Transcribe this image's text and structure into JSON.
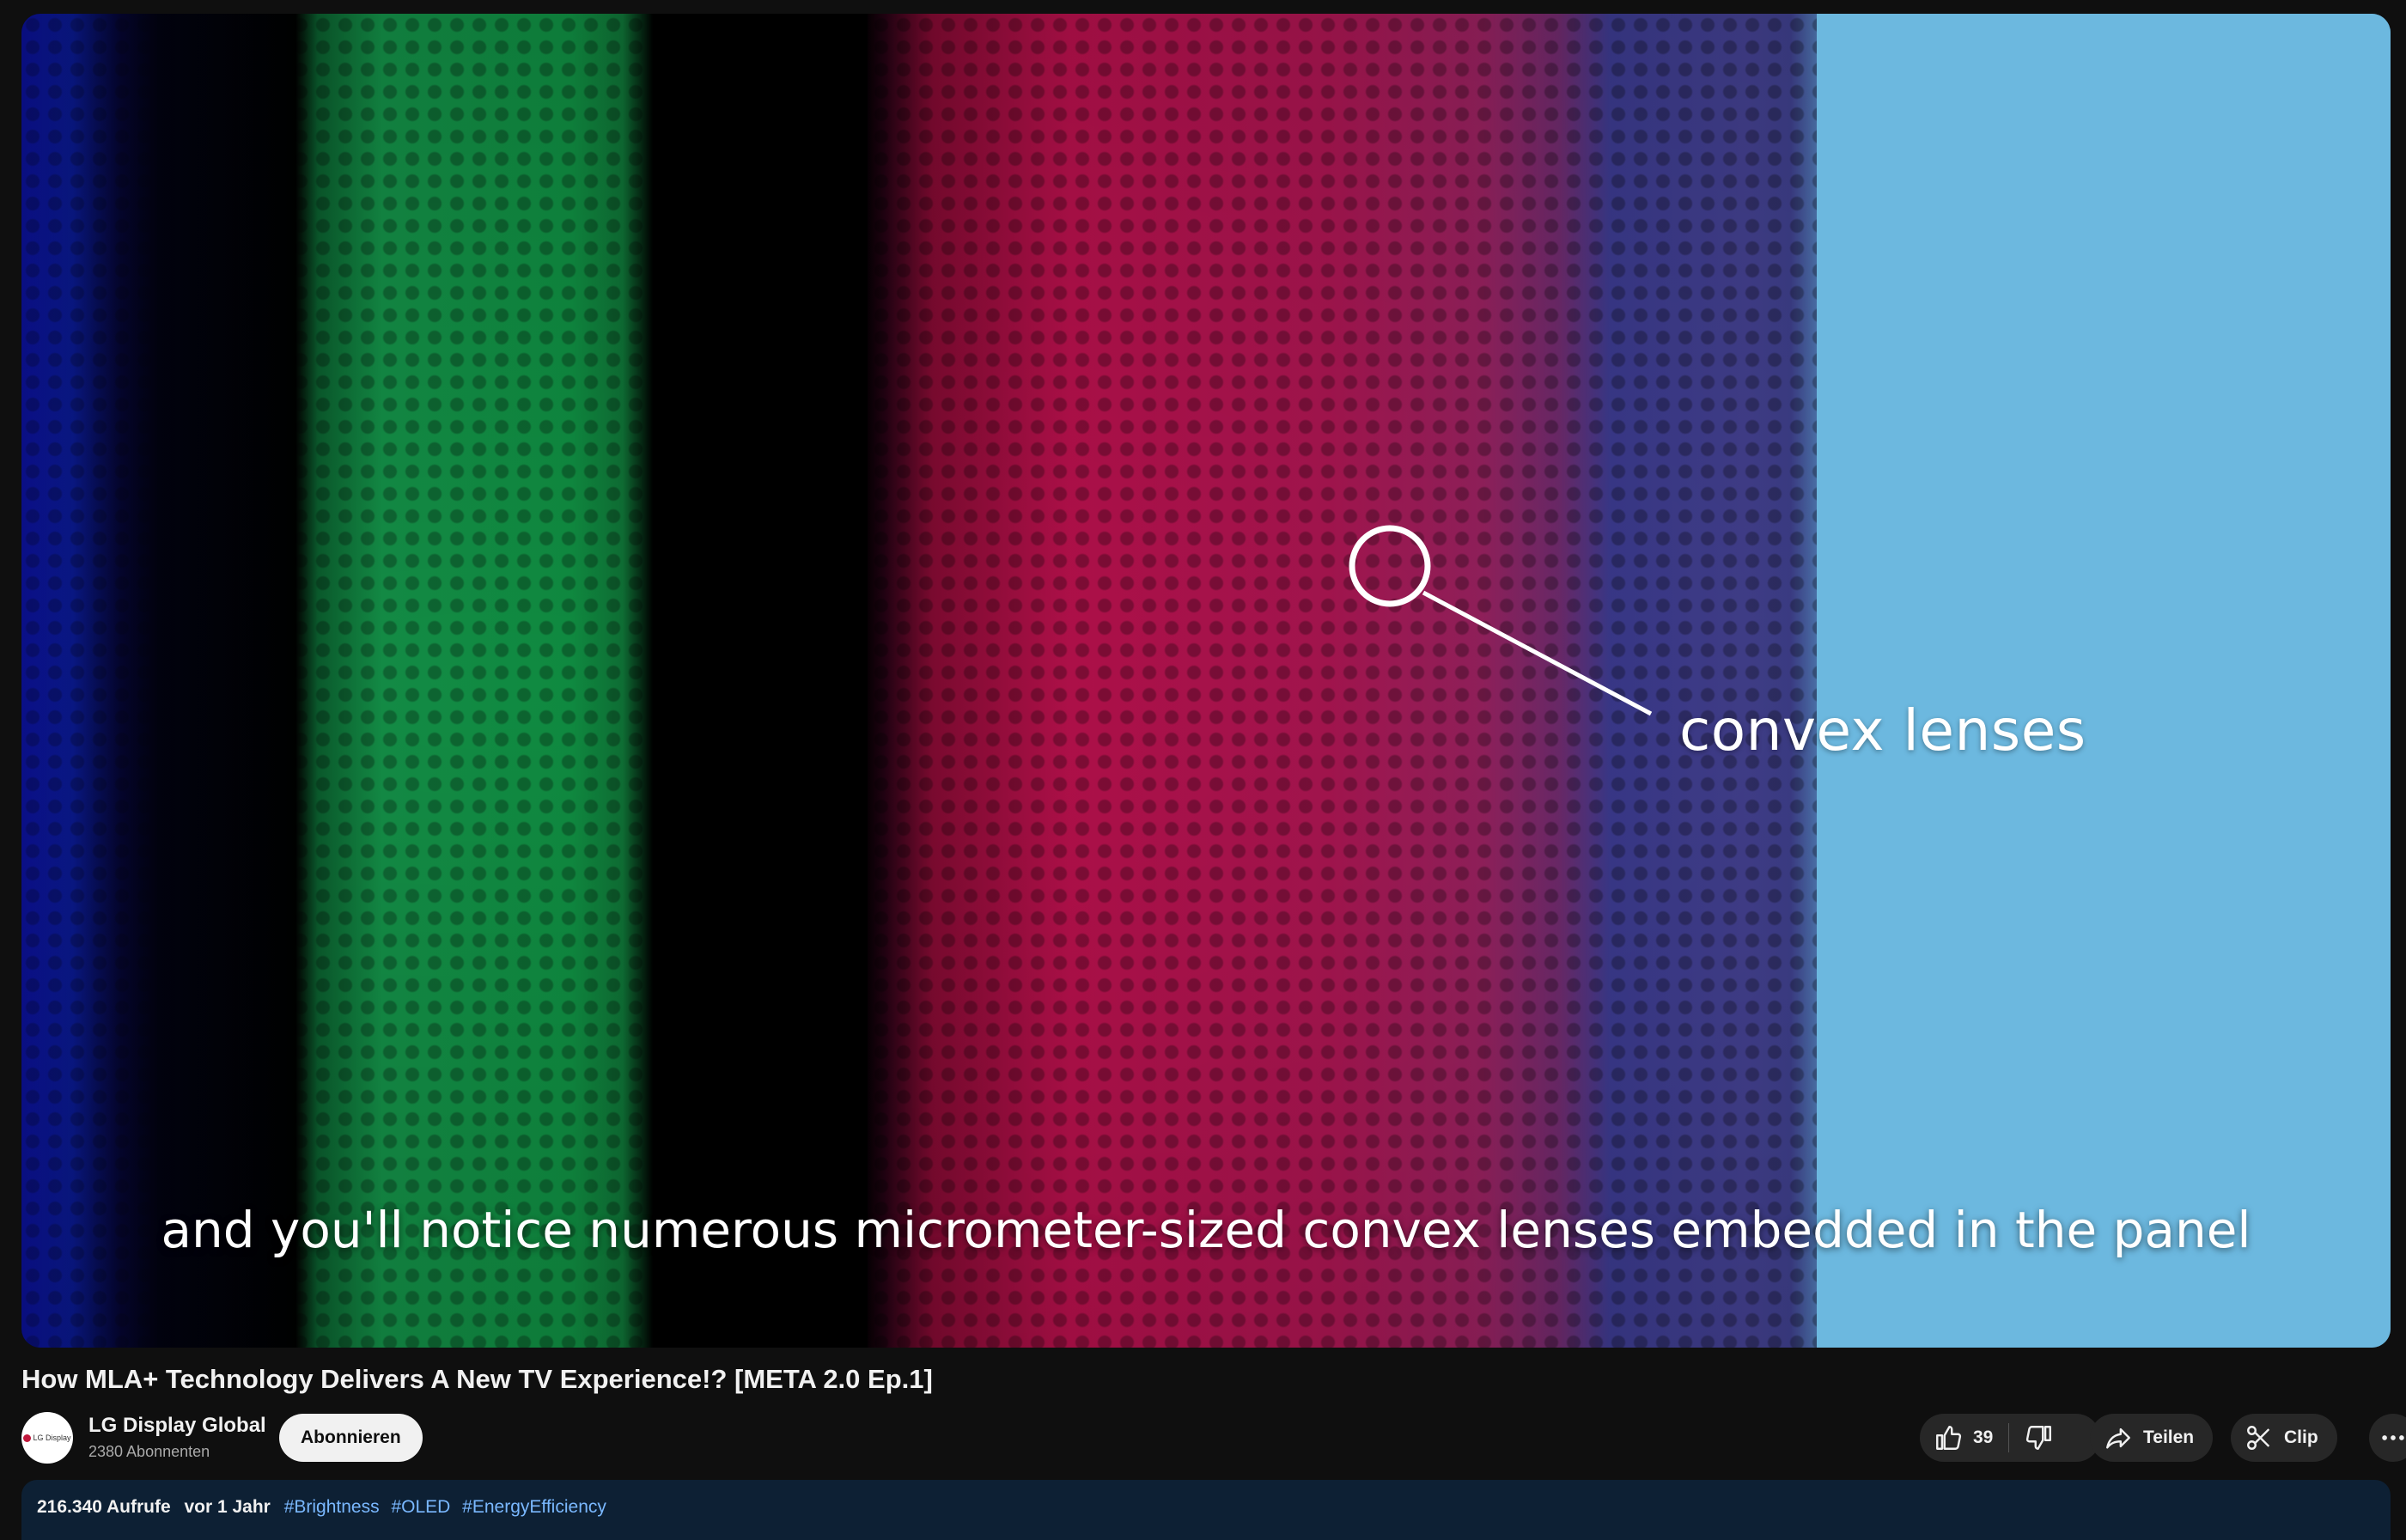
{
  "video": {
    "callout_label": "convex lenses",
    "caption": "and you'll notice numerous micrometer-sized convex lenses embedded in the panel"
  },
  "title": "How MLA+ Technology Delivers A New TV Experience!? [META 2.0 Ep.1]",
  "channel": {
    "name": "LG Display Global",
    "subscribers": "2380 Abonnenten",
    "avatar_text": "LG Display",
    "subscribe_label": "Abonnieren"
  },
  "actions": {
    "like_count": "39",
    "share_label": "Teilen",
    "clip_label": "Clip",
    "like_icon": "thumbs-up-icon",
    "dislike_icon": "thumbs-down-icon",
    "share_icon": "share-arrow-icon",
    "clip_icon": "scissors-icon",
    "more_icon": "more-horizontal-icon"
  },
  "description": {
    "views": "216.340 Aufrufe",
    "age": "vor 1 Jahr",
    "hashtags": [
      "#Brightness",
      "#OLED",
      "#EnergyEfficiency"
    ]
  },
  "colors": {
    "background": "#0f0f0f",
    "pill": "#272727",
    "description_bg": "#0d2034",
    "hashtag": "#7ab8ff"
  }
}
